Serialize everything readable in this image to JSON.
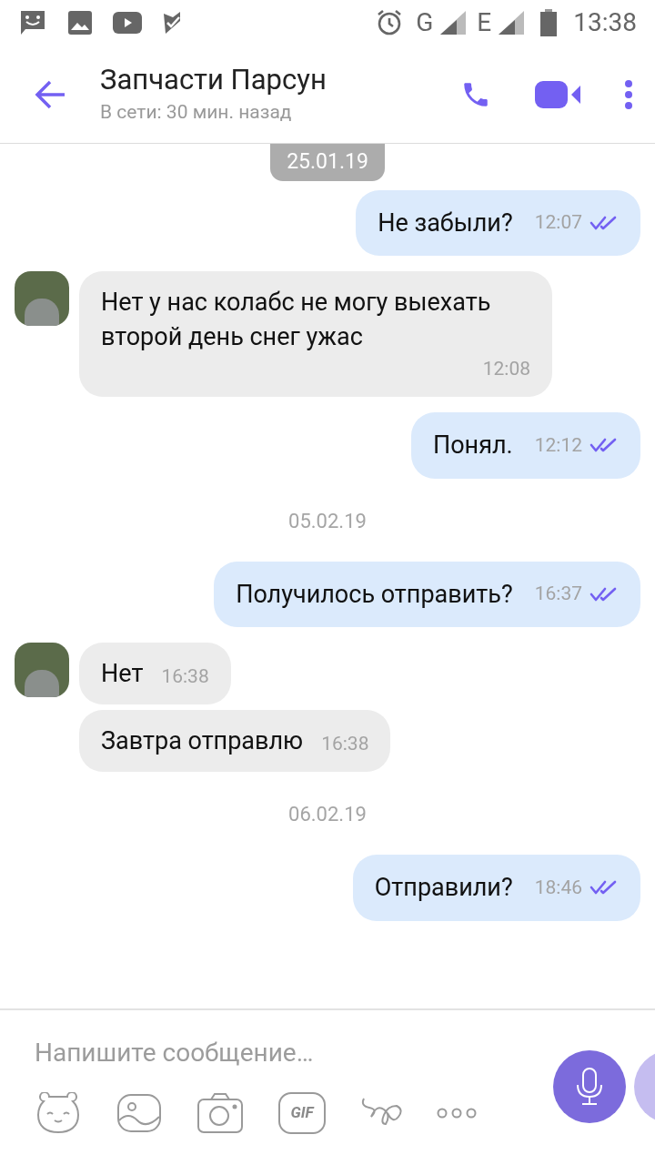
{
  "status_bar": {
    "network_1": "G",
    "network_2": "E",
    "time": "13:38"
  },
  "header": {
    "title": "Запчасти Парсун",
    "subtitle": "В сети: 30 мин. назад"
  },
  "messages": [
    {
      "kind": "date",
      "text": "25.01.19",
      "pinned": true
    },
    {
      "kind": "outgoing",
      "text": "Не забыли?",
      "time": "12:07"
    },
    {
      "kind": "incoming",
      "text": "Нет у нас колабс не могу выехать второй день снег ужас",
      "time": "12:08",
      "avatar": true
    },
    {
      "kind": "outgoing",
      "text": "Понял.",
      "time": "12:12"
    },
    {
      "kind": "date",
      "text": "05.02.19",
      "pinned": false
    },
    {
      "kind": "outgoing",
      "text": "Получилось отправить?",
      "time": "16:37"
    },
    {
      "kind": "incoming",
      "text": "Нет",
      "time": "16:38",
      "avatar": true
    },
    {
      "kind": "incoming",
      "text": "Завтра отправлю",
      "time": "16:38",
      "avatar": false
    },
    {
      "kind": "date",
      "text": "06.02.19",
      "pinned": false
    },
    {
      "kind": "outgoing",
      "text": "Отправили?",
      "time": "18:46"
    }
  ],
  "composer": {
    "placeholder": "Напишите сообщение…",
    "gif_label": "GIF"
  }
}
